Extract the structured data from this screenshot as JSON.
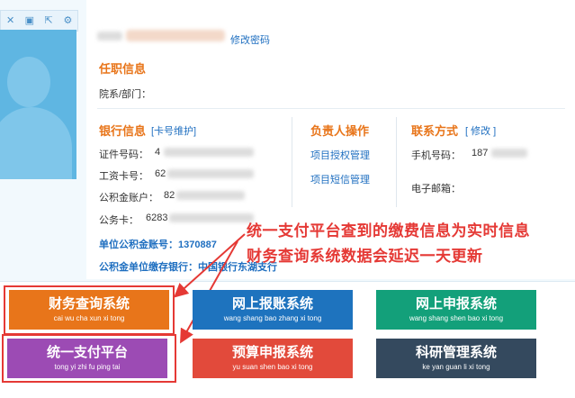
{
  "header": {
    "change_password": "修改密码"
  },
  "job": {
    "title": "任职信息",
    "dept_label": "院系/部门："
  },
  "bank": {
    "title": "银行信息",
    "card_maintain": "[卡号维护]",
    "id_label": "证件号码：",
    "id_prefix": "4",
    "salary_label": "工资卡号：",
    "salary_prefix": "62",
    "fund_label": "公积金账户：",
    "fund_prefix": "82",
    "official_label": "公务卡：",
    "official_prefix": "6283",
    "unit_fund_label": "单位公积金账号：",
    "unit_fund_value": "1370887",
    "fund_bank_label": "公积金单位缴存银行：",
    "fund_bank_value": "中国银行东湖支行"
  },
  "owner": {
    "title": "负责人操作",
    "auth": "项目授权管理",
    "sms": "项目短信管理"
  },
  "contact": {
    "title": "联系方式",
    "edit": "[ 修改 ]",
    "phone_label": "手机号码：",
    "phone_prefix": "187",
    "email_label": "电子邮箱："
  },
  "annotation": {
    "line1": "统一支付平台查到的缴费信息为实时信息",
    "line2": "财务查询系统数据会延迟一天更新"
  },
  "systems": [
    {
      "cn": "财务查询系统",
      "py": "cai wu cha xun xi tong",
      "color": "#e8751a"
    },
    {
      "cn": "网上报账系统",
      "py": "wang shang bao zhang xi tong",
      "color": "#1e73be"
    },
    {
      "cn": "网上申报系统",
      "py": "wang shang shen bao xi tong",
      "color": "#13a07a"
    },
    {
      "cn": "统一支付平台",
      "py": "tong yi zhi fu ping tai",
      "color": "#9c4bb4"
    },
    {
      "cn": "预算申报系统",
      "py": "yu suan shen bao xi tong",
      "color": "#e24a3b"
    },
    {
      "cn": "科研管理系统",
      "py": "ke yan guan li xi tong",
      "color": "#34495e"
    }
  ]
}
